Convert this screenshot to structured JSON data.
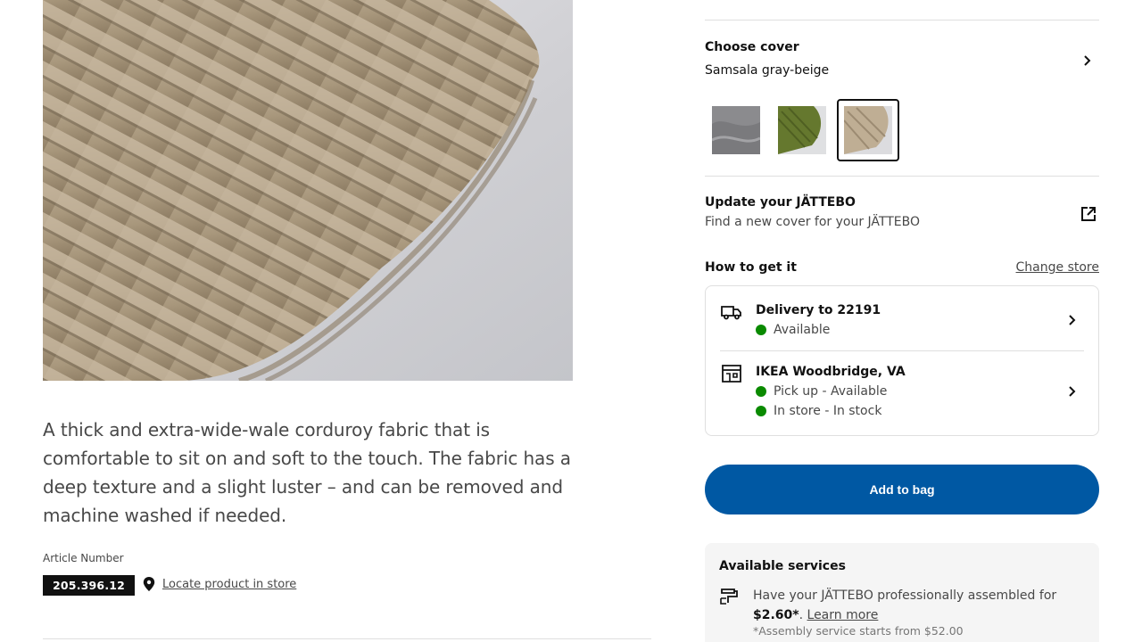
{
  "product": {
    "image_alt": "Close-up of folded beige corduroy fabric",
    "description": "A thick and extra-wide-wale corduroy fabric that is comfortable to sit on and soft to the touch. The fabric has a deep texture and a slight luster – and can be removed and machine washed if needed.",
    "article_label": "Article Number",
    "article_number": "205.396.12",
    "locate_label": "Locate product in store"
  },
  "cover": {
    "title": "Choose cover",
    "selected": "Samsala gray-beige",
    "swatches": [
      {
        "name": "gray",
        "color": "#8a8a8c"
      },
      {
        "name": "green",
        "color": "#6b7a34"
      },
      {
        "name": "gray-beige",
        "color": "#c3b29a",
        "selected": true
      }
    ]
  },
  "update": {
    "title": "Update your JÄTTEBO",
    "subtitle": "Find a new cover for your JÄTTEBO"
  },
  "how_to_get": {
    "title": "How to get it",
    "change_store": "Change store",
    "delivery": {
      "title": "Delivery to 22191",
      "status": "Available"
    },
    "store": {
      "title": "IKEA Woodbridge, VA",
      "pickup": "Pick up - Available",
      "instore": "In store - In stock"
    },
    "status_color": "#0a8a00"
  },
  "add_to_bag": "Add to bag",
  "services": {
    "title": "Available services",
    "text_prefix": "Have your JÄTTEBO professionally assembled for",
    "price": "$2.60*",
    "learn_more": "Learn more",
    "note": "*Assembly service starts from $52.00"
  },
  "colors": {
    "primary_blue": "#0058a3",
    "available_green": "#0a8a00"
  }
}
